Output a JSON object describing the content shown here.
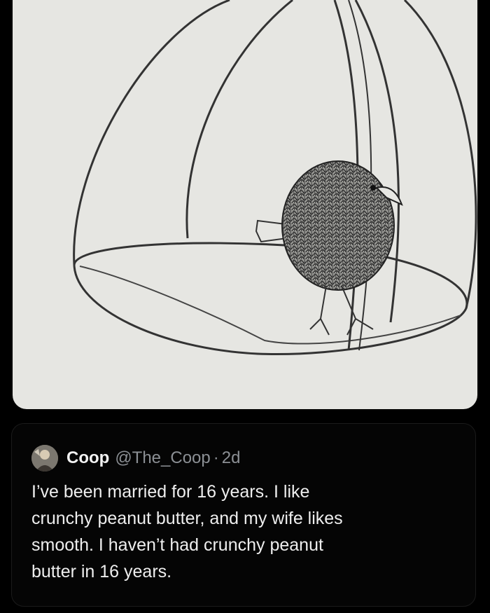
{
  "tweet": {
    "display_name": "Coop",
    "handle": "@The_Coop",
    "separator": "·",
    "time": "2d",
    "text_lines": [
      "I’ve been married for 16 years.  I like",
      "crunchy peanut butter, and my wife likes",
      "smooth.  I haven’t had crunchy peanut",
      "butter in 16 years."
    ]
  },
  "image": {
    "description_icon": "bird-in-cage-drawing"
  },
  "colors": {
    "background": "#000000",
    "paper": "#e6e6e2",
    "name": "#f2f2f2",
    "muted": "#8b8f94",
    "text": "#eeeeee"
  }
}
